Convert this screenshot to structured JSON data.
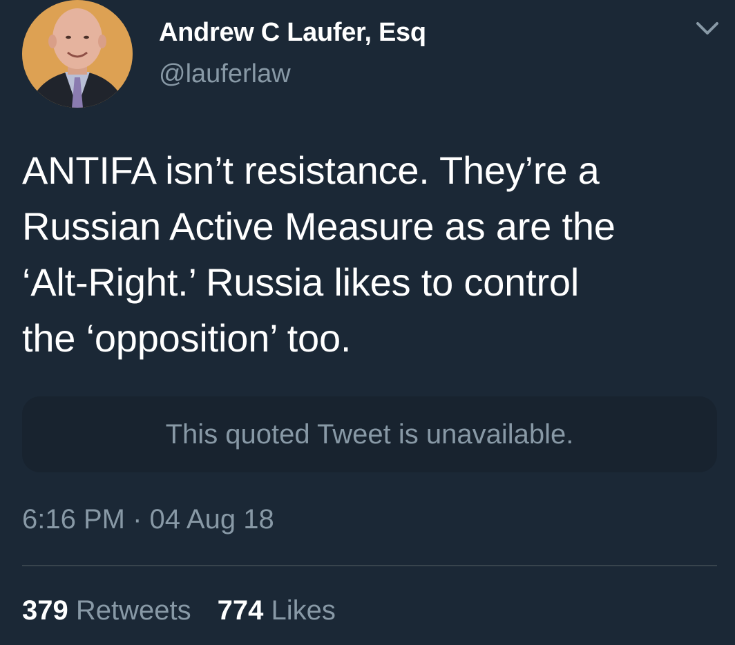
{
  "tweet": {
    "author": {
      "display_name": "Andrew C Laufer, Esq",
      "handle": "@lauferlaw"
    },
    "menu_icon": "chevron-down-icon",
    "text": "ANTIFA isn’t resistance.  They’re a\nRussian Active Measure as are the\n‘Alt-Right.’ Russia likes to control\nthe ‘opposition’ too.",
    "quoted_tweet_notice": "This quoted Tweet is unavailable.",
    "timestamp": "6:16 PM · 04 Aug 18",
    "stats": {
      "retweets_count": "379",
      "retweets_label": "Retweets",
      "likes_count": "774",
      "likes_label": "Likes"
    }
  },
  "colors": {
    "background": "#1b2836",
    "primary_text": "#ffffff",
    "secondary_text": "#8899a6",
    "quote_box": "#18232f",
    "divider": "#38444d"
  }
}
